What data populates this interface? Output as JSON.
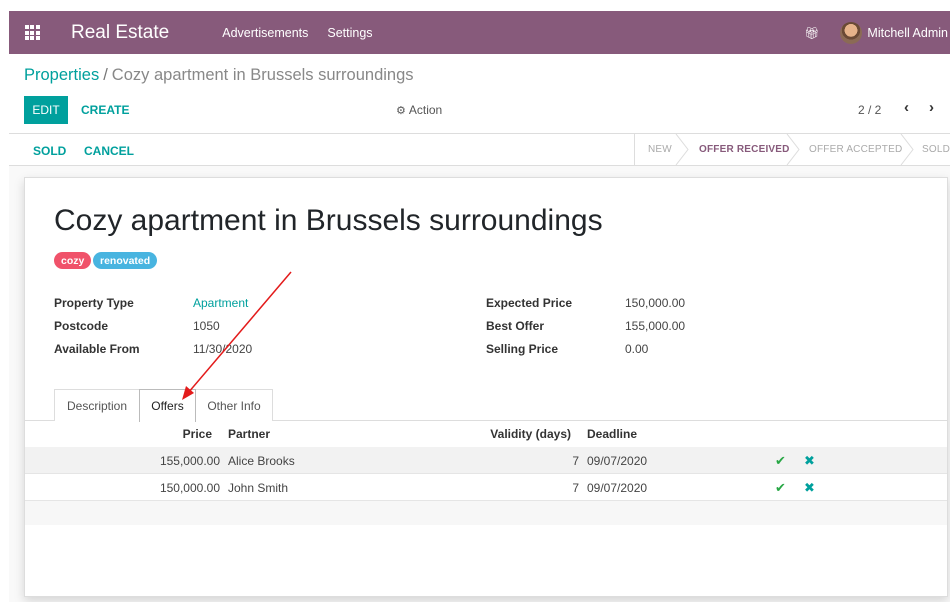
{
  "navbar": {
    "brand": "Real Estate",
    "menu": [
      "Advertisements",
      "Settings"
    ],
    "user_name": "Mitchell Admin",
    "icons": {
      "apps": "apps-grid-icon",
      "gift": "gift-icon"
    },
    "color": "#875a7b"
  },
  "breadcrumb": {
    "parent": "Properties",
    "separator": "/",
    "current": "Cozy apartment in Brussels surroundings"
  },
  "control": {
    "edit_label": "EDIT",
    "create_label": "CREATE",
    "action_label": "Action",
    "pager": "2 / 2",
    "prev_icon": "‹",
    "next_icon": "›"
  },
  "statusbar": {
    "buttons": [
      "SOLD",
      "CANCEL"
    ],
    "stages": [
      "NEW",
      "OFFER RECEIVED",
      "OFFER ACCEPTED",
      "SOLD"
    ],
    "active_stage": "OFFER RECEIVED"
  },
  "record": {
    "title": "Cozy apartment in Brussels surroundings",
    "tags": [
      {
        "label": "cozy",
        "color": "#f0526a"
      },
      {
        "label": "renovated",
        "color": "#48b4e0"
      }
    ],
    "left_fields": [
      {
        "label": "Property Type",
        "value": "Apartment"
      },
      {
        "label": "Postcode",
        "value": "1050"
      },
      {
        "label": "Available From",
        "value": "11/30/2020"
      }
    ],
    "right_fields": [
      {
        "label": "Expected Price",
        "value": "150,000.00"
      },
      {
        "label": "Best Offer",
        "value": "155,000.00"
      },
      {
        "label": "Selling Price",
        "value": "0.00"
      }
    ]
  },
  "tabs": {
    "items": [
      "Description",
      "Offers",
      "Other Info"
    ],
    "active": "Offers"
  },
  "offers": {
    "columns": [
      "Price",
      "Partner",
      "Validity (days)",
      "Deadline"
    ],
    "rows": [
      {
        "price": "155,000.00",
        "partner": "Alice Brooks",
        "validity": "7",
        "deadline": "09/07/2020"
      },
      {
        "price": "150,000.00",
        "partner": "John Smith",
        "validity": "7",
        "deadline": "09/07/2020"
      }
    ],
    "accept_icon": "✔",
    "refuse_icon": "✖",
    "accept_color": "#28a745",
    "refuse_color": "#00a09d"
  },
  "annotation": {
    "arrow_color": "#e31b1b"
  }
}
